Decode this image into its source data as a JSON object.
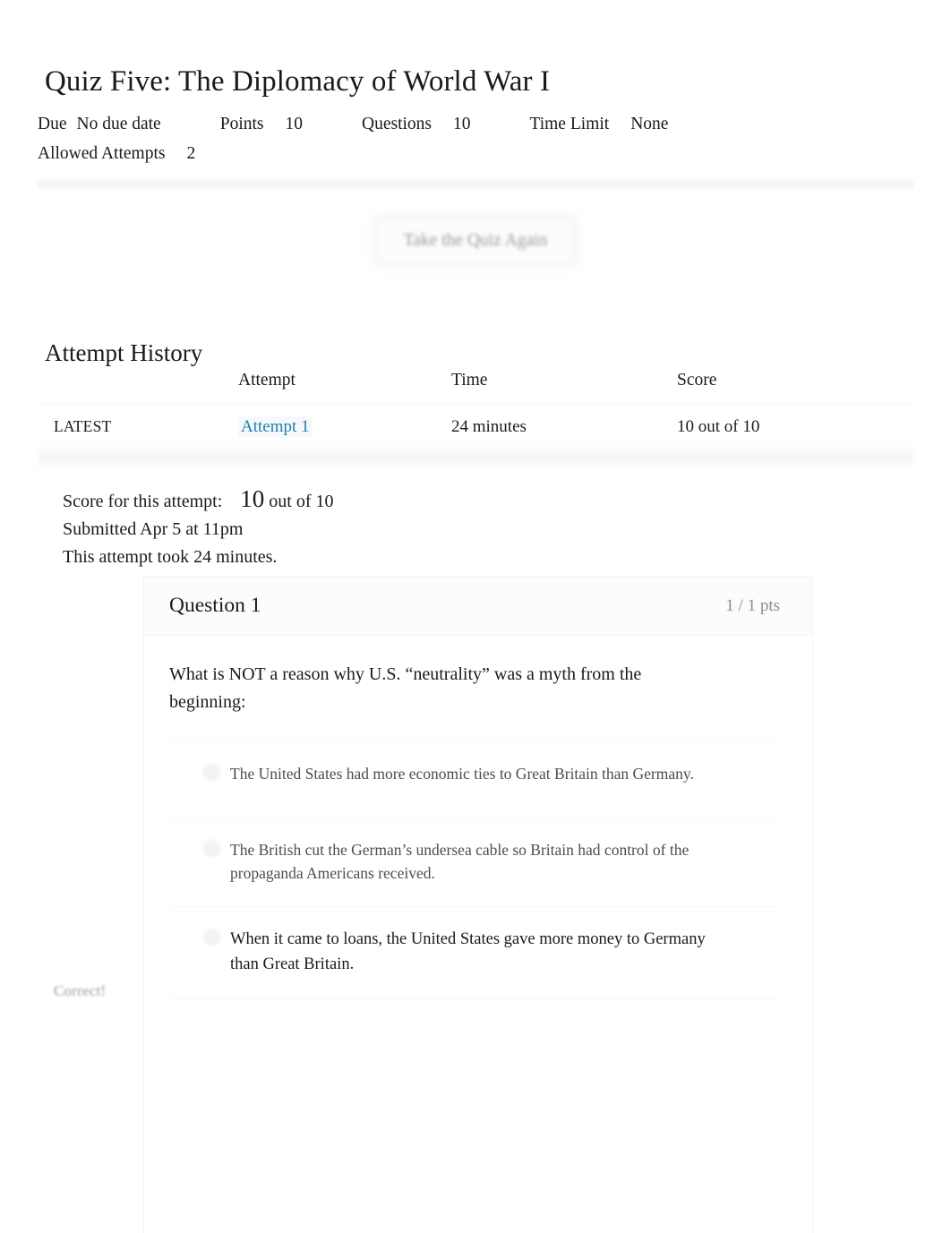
{
  "quiz": {
    "title": "Quiz Five: The Diplomacy of World War I"
  },
  "meta": {
    "due_label": "Due",
    "due_value": "No due date",
    "points_label": "Points",
    "points_value": "10",
    "questions_label": "Questions",
    "questions_value": "10",
    "time_limit_label": "Time Limit",
    "time_limit_value": "None",
    "allowed_attempts_label": "Allowed Attempts",
    "allowed_attempts_value": "2"
  },
  "actions": {
    "retake_label": "Take the Quiz Again"
  },
  "attempt_history": {
    "heading": "Attempt History",
    "columns": [
      "",
      "Attempt",
      "Time",
      "Score"
    ],
    "rows": [
      {
        "kept": "LATEST",
        "attempt": "Attempt 1",
        "time": "24 minutes",
        "score": "10 out of 10"
      }
    ]
  },
  "score_summary": {
    "score_label": "Score for this attempt:",
    "score_value": "10",
    "score_out_of": "out of 10",
    "submitted": "Submitted Apr 5 at 11pm",
    "duration": "This attempt took 24 minutes."
  },
  "question": {
    "name": "Question 1",
    "points": "1 / 1 pts",
    "text": "What is NOT a reason why U.S. “neutrality” was a myth from the beginning:",
    "correct_flag": "Correct!",
    "answers": [
      {
        "text": "The United States had more economic ties to Great Britain than Germany.",
        "selected": false
      },
      {
        "text": "The British cut the German’s undersea cable so Britain had control of the propaganda Americans received.",
        "selected": false
      },
      {
        "text": "When it came to loans, the United States gave more money to Germany than Great Britain.",
        "selected": true
      }
    ]
  },
  "colors": {
    "link": "#1f7fa8",
    "text": "#1a1a1a",
    "muted": "#8b8b8b",
    "answer_text": "#4c4c55"
  }
}
